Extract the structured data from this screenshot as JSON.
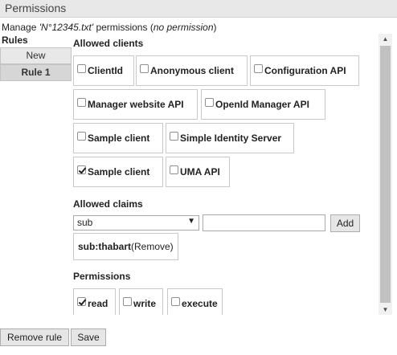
{
  "header": {
    "title": "Permissions"
  },
  "subtitle": {
    "prefix": "Manage ",
    "resource": "'N°12345.txt'",
    "middle": " permissions (",
    "status": "no permission",
    "suffix": ")"
  },
  "rules": {
    "heading": "Rules",
    "new_label": "New",
    "items": [
      {
        "label": "Rule 1"
      }
    ]
  },
  "allowed_clients": {
    "title": "Allowed clients",
    "items": [
      {
        "label": "ClientId",
        "checked": false
      },
      {
        "label": "Anonymous client",
        "checked": false
      },
      {
        "label": "Configuration API",
        "checked": false
      },
      {
        "label": "Manager website API",
        "checked": false
      },
      {
        "label": "OpenId Manager API",
        "checked": false
      },
      {
        "label": "Sample client",
        "checked": false
      },
      {
        "label": "Simple Identity Server",
        "checked": false
      },
      {
        "label": "Sample client",
        "checked": true
      },
      {
        "label": "UMA API",
        "checked": false
      }
    ]
  },
  "allowed_claims": {
    "title": "Allowed claims",
    "selected": "sub",
    "value_input": "",
    "add_label": "Add",
    "items": [
      {
        "claim": "sub:thabart",
        "remove_label": "(Remove)"
      }
    ]
  },
  "permissions": {
    "title": "Permissions",
    "items": [
      {
        "label": "read",
        "checked": true
      },
      {
        "label": "write",
        "checked": false
      },
      {
        "label": "execute",
        "checked": false
      }
    ]
  },
  "footer": {
    "remove_rule_label": "Remove rule",
    "save_label": "Save"
  }
}
